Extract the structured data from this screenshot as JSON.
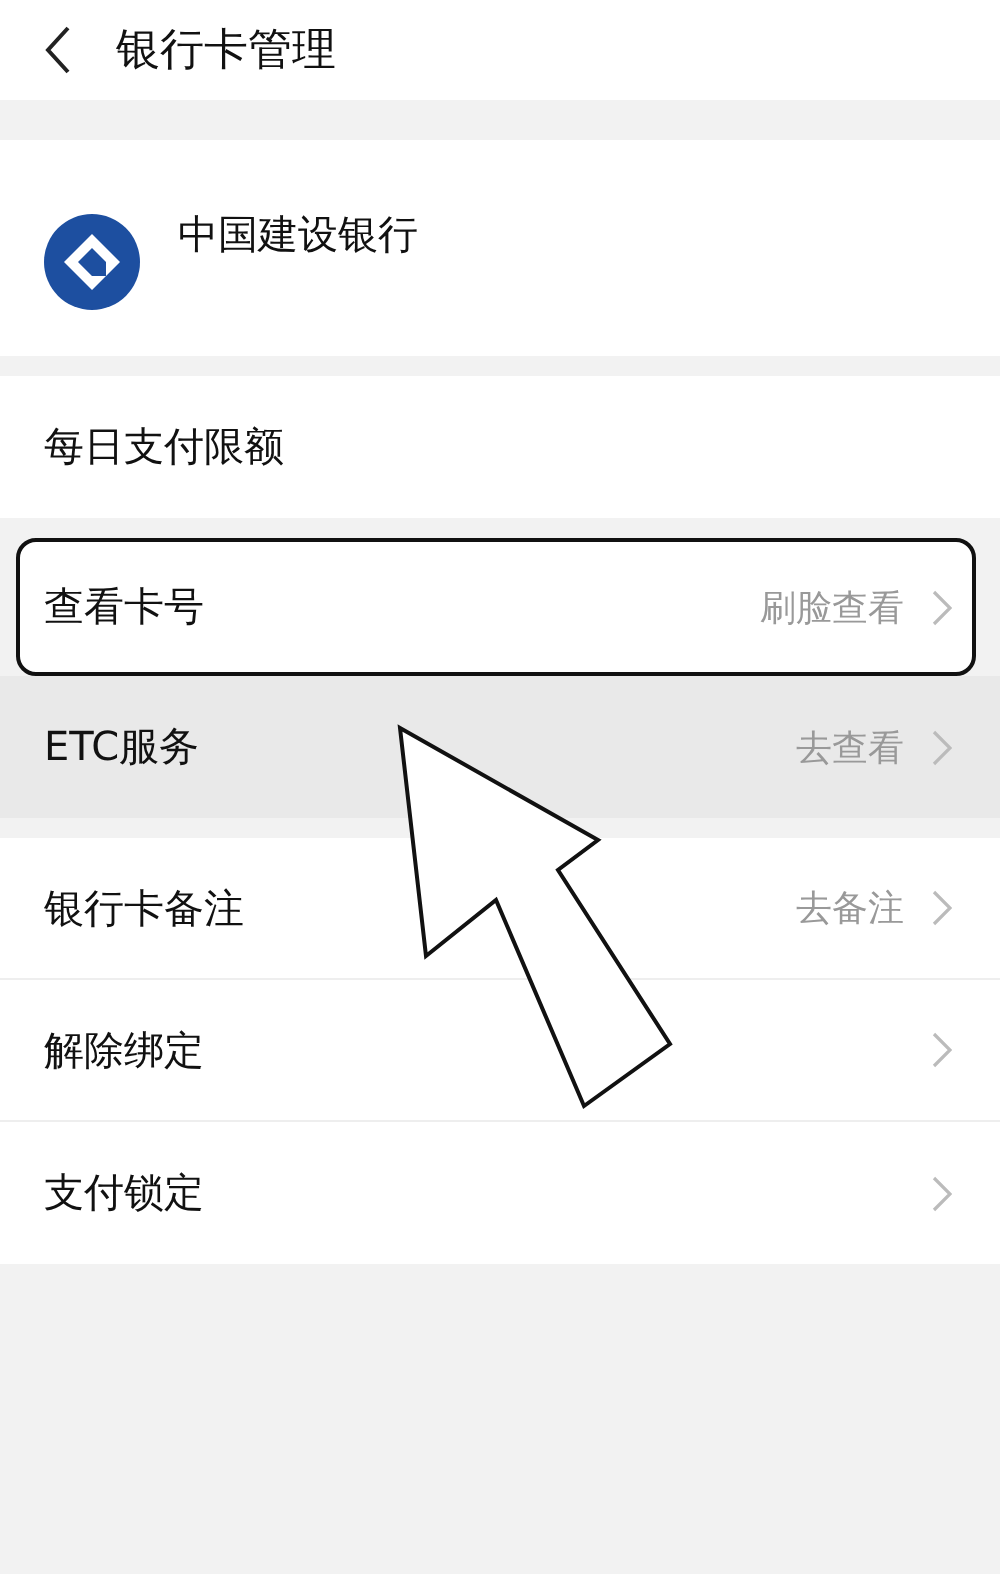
{
  "header": {
    "title": "银行卡管理"
  },
  "bank": {
    "name": "中国建设银行"
  },
  "limit_row": {
    "label": "每日支付限额"
  },
  "card_rows": [
    {
      "label": "查看卡号",
      "hint": "刷脸查看",
      "highlighted": true,
      "pressed": false
    },
    {
      "label": "ETC服务",
      "hint": "去查看",
      "highlighted": false,
      "pressed": true
    }
  ],
  "settings_rows": [
    {
      "label": "银行卡备注",
      "hint": "去备注"
    },
    {
      "label": "解除绑定"
    },
    {
      "label": "支付锁定"
    }
  ]
}
